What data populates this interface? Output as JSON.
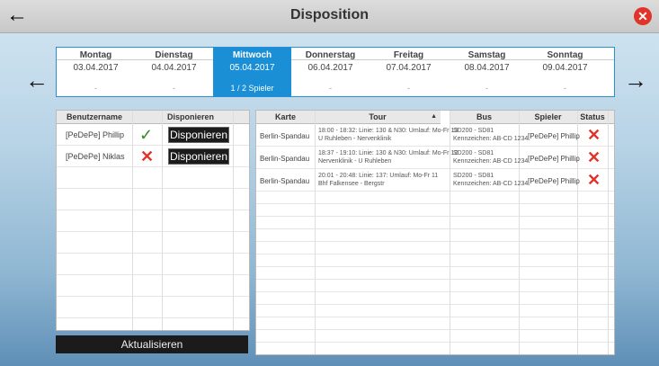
{
  "header": {
    "title": "Disposition",
    "back_icon": "←",
    "close_icon": "✕"
  },
  "nav": {
    "prev_icon": "←",
    "next_icon": "→"
  },
  "days": [
    {
      "name": "Montag",
      "date": "03.04.2017",
      "count": "-"
    },
    {
      "name": "Dienstag",
      "date": "04.04.2017",
      "count": "-"
    },
    {
      "name": "Mittwoch",
      "date": "05.04.2017",
      "count": "1 / 2 Spieler"
    },
    {
      "name": "Donnerstag",
      "date": "06.04.2017",
      "count": "-"
    },
    {
      "name": "Freitag",
      "date": "07.04.2017",
      "count": "-"
    },
    {
      "name": "Samstag",
      "date": "08.04.2017",
      "count": "-"
    },
    {
      "name": "Sonntag",
      "date": "09.04.2017",
      "count": "-"
    }
  ],
  "users_table": {
    "headers": {
      "username": "Benutzername",
      "dispose": "Disponieren"
    },
    "rows": [
      {
        "username": "[PeDePe] Phillip",
        "status": "check",
        "button": "Disponieren"
      },
      {
        "username": "[PeDePe] Niklas",
        "status": "cross",
        "button": "Disponieren"
      }
    ]
  },
  "tours_table": {
    "headers": {
      "map": "Karte",
      "tour": "Tour",
      "sort": "▲",
      "bus": "Bus",
      "player": "Spieler",
      "status": "Status"
    },
    "rows": [
      {
        "map": "Berlin-Spandau",
        "tour1": "18:00 - 18:32: Linie: 130 & N30: Umlauf: Mo-Fr 13",
        "tour2": "U Ruhleben - Nervenklinik",
        "bus1": "SD200 - SD81",
        "bus2": "Kennzeichen: AB-CD 1234",
        "player": "[PeDePe] Phillip",
        "status": "✕"
      },
      {
        "map": "Berlin-Spandau",
        "tour1": "18:37 - 19:10: Linie: 130 & N30: Umlauf: Mo-Fr 12",
        "tour2": "Nervenklinik - U Ruhleben",
        "bus1": "SD200 - SD81",
        "bus2": "Kennzeichen: AB-CD 1234",
        "player": "[PeDePe] Phillip",
        "status": "✕"
      },
      {
        "map": "Berlin-Spandau",
        "tour1": "20:01 - 20:48: Linie: 137: Umlauf: Mo-Fr 11",
        "tour2": "Bhf Falkensee - Bergstr",
        "bus1": "SD200 - SD81",
        "bus2": "Kennzeichen: AB-CD 1234",
        "player": "[PeDePe] Phillip",
        "status": "✕"
      }
    ]
  },
  "refresh_label": "Aktualisieren",
  "colors": {
    "accent": "#1a8fd6",
    "danger": "#e0342b",
    "ok": "#3a8a2a"
  }
}
